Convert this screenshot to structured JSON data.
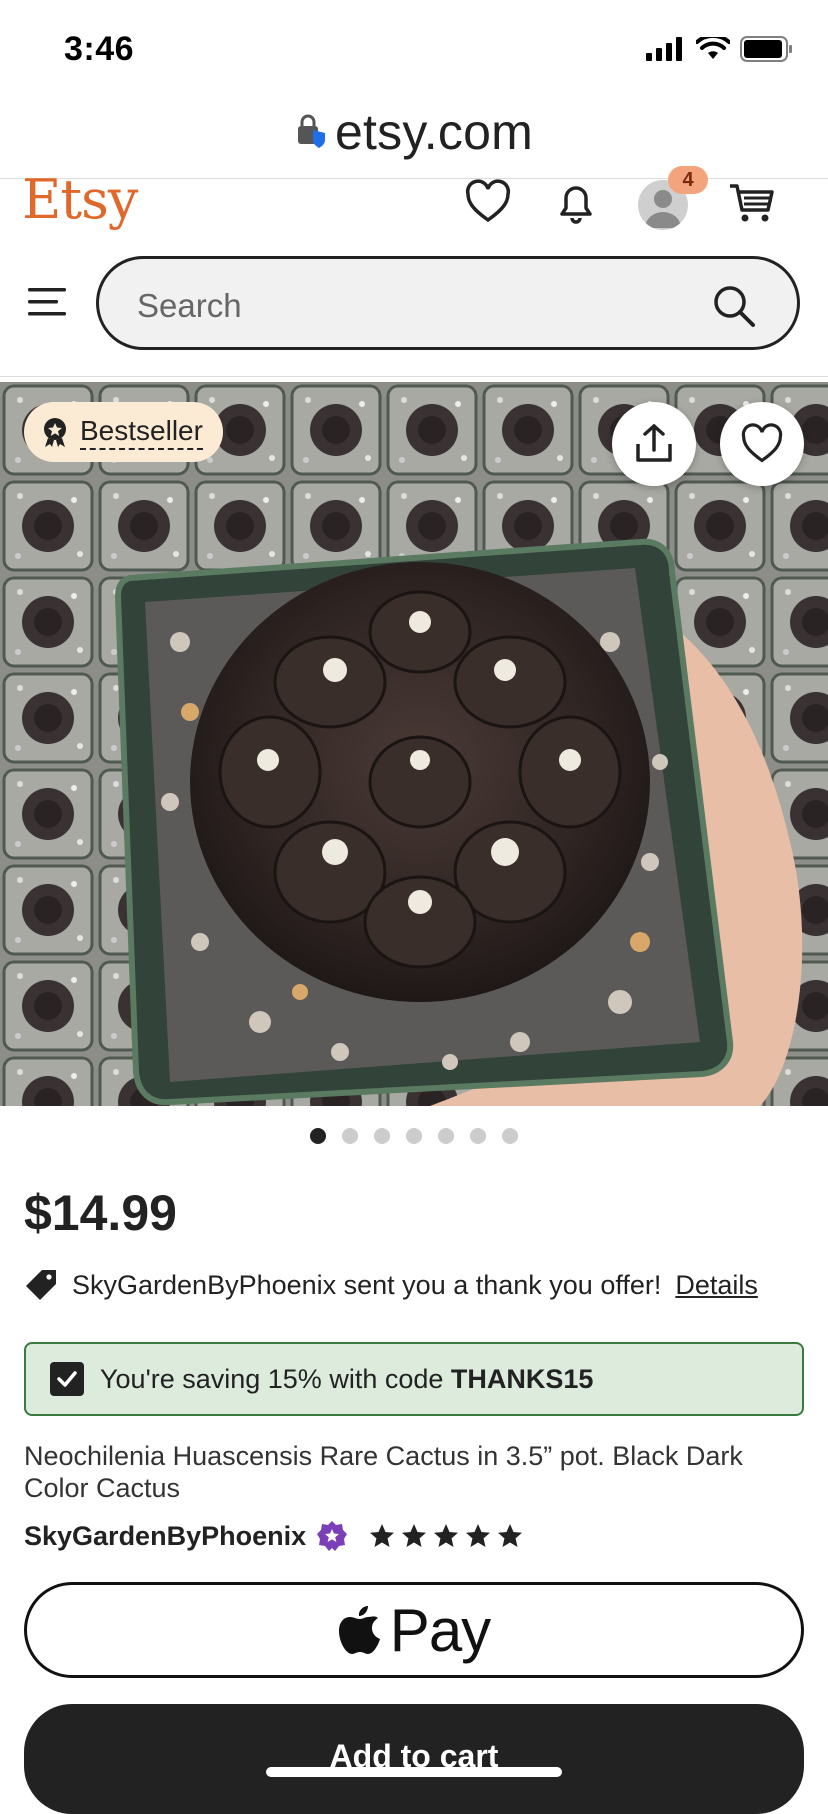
{
  "status": {
    "time": "3:46"
  },
  "browser": {
    "url": "etsy.com"
  },
  "header": {
    "logo": "Etsy",
    "cart_badge": "4"
  },
  "search": {
    "placeholder": "Search"
  },
  "listing": {
    "badge": "Bestseller",
    "image_count": 7,
    "active_image_index": 0,
    "price": "$14.99",
    "offer_text": "SkyGardenByPhoenix sent you a thank you offer!",
    "offer_link": "Details",
    "coupon_prefix": "You're saving 15% with code",
    "coupon_code": "THANKS15",
    "title": "Neochilenia Huascensis Rare Cactus in 3.5” pot. Black Dark Color Cactus",
    "shop_name": "SkyGardenByPhoenix",
    "rating_stars": 5
  },
  "buttons": {
    "apple_pay": "Pay",
    "add_to_cart": "Add to cart"
  },
  "colors": {
    "etsy_orange": "#E0682A",
    "coupon_bg": "#DDEBDD",
    "coupon_border": "#3a7a3f",
    "star_seller_purple": "#7B3FB8"
  }
}
